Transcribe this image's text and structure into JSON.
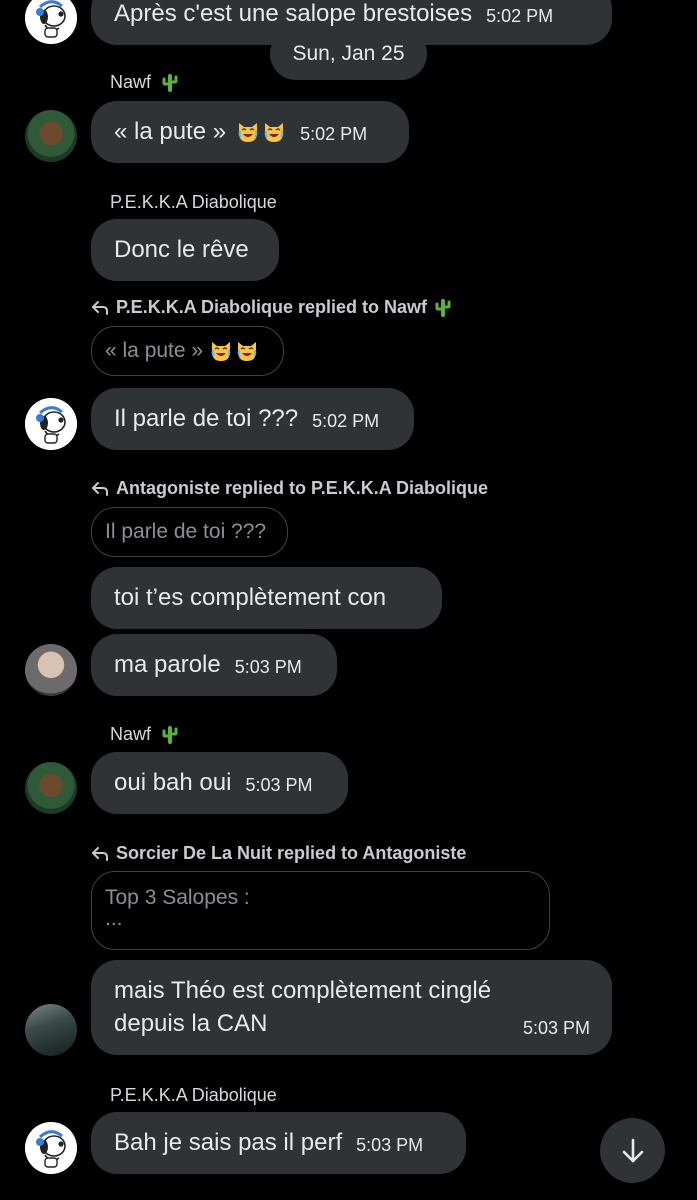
{
  "date_divider": "Sun, Jan 25",
  "messages": [
    {
      "text": "Après c'est une salope brestoises",
      "time": "5:02 PM"
    },
    {
      "sender": "Nawf",
      "text": "« la pute »",
      "time": "5:02 PM"
    },
    {
      "sender": "P.E.K.K.A Diabolique",
      "text": "Donc le rêve"
    },
    {
      "reply_header": "P.E.K.K.A Diabolique replied to Nawf",
      "quote": "« la pute »",
      "text": "Il parle de toi ???",
      "time": "5:02 PM"
    },
    {
      "reply_header": "Antagoniste replied to P.E.K.K.A Diabolique",
      "quote": "Il parle de toi ???",
      "text": "toi t’es complètement con"
    },
    {
      "text": "ma parole",
      "time": "5:03 PM"
    },
    {
      "sender": "Nawf",
      "text": "oui bah oui",
      "time": "5:03 PM"
    },
    {
      "reply_header": "Sorcier De La Nuit replied to Antagoniste",
      "quote_line1": "Top 3 Salopes :",
      "quote_line2": "...",
      "text_line1": "mais Théo est complètement cinglé",
      "text_line2": "depuis la CAN",
      "time": "5:03 PM"
    },
    {
      "sender": "P.E.K.K.A Diabolique",
      "text": "Bah je sais pas il perf",
      "time": "5:03 PM"
    }
  ],
  "icons": {
    "reply": "reply-arrow-icon",
    "cactus": "cactus-emoji",
    "laugh": "crying-laughing-cat-emoji",
    "scroll": "arrow-down-icon"
  },
  "colors": {
    "background": "#000000",
    "bubble": "#2f3336",
    "text": "#e7e9ea",
    "muted": "#8b9095"
  }
}
